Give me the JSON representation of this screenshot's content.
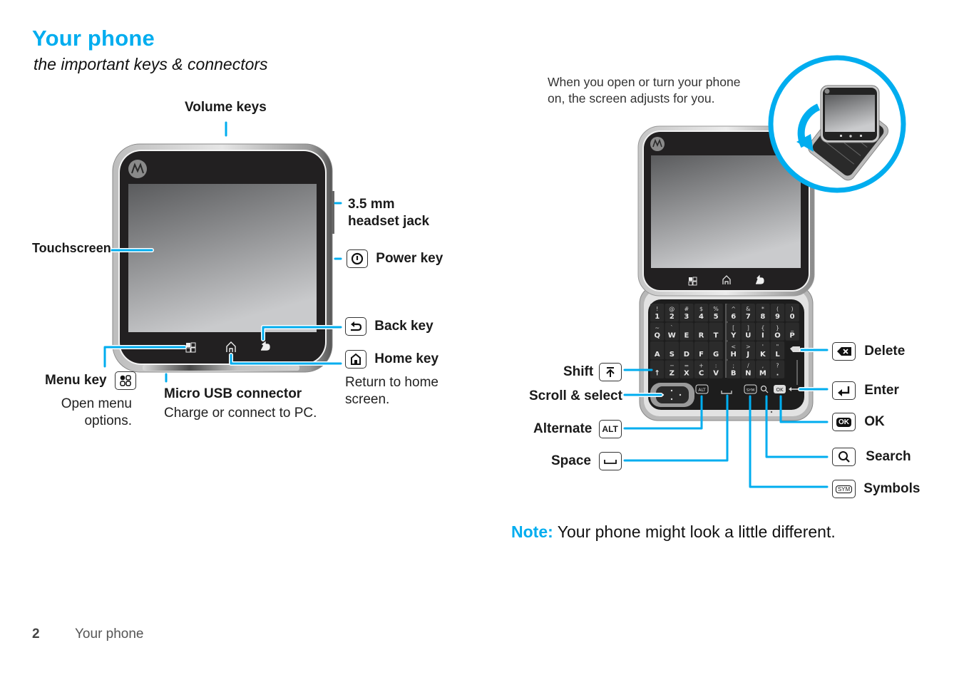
{
  "page": {
    "title": "Your phone",
    "subtitle": "the important keys & connectors",
    "footer": {
      "page_number": "2",
      "section": "Your phone"
    },
    "note": {
      "prefix": "Note:",
      "text": " Your phone might look a little different."
    },
    "accent_color": "#00adef"
  },
  "front_diagram": {
    "labels": {
      "volume_keys": "Volume keys",
      "headset_jack_line1": "3.5 mm",
      "headset_jack_line2": "headset jack",
      "touchscreen": "Touchscreen",
      "power_key": "Power key",
      "back_key": "Back key",
      "home_key": "Home key",
      "home_key_desc_line1": "Return to home",
      "home_key_desc_line2": "screen.",
      "menu_key": "Menu key",
      "menu_key_desc_line1": "Open menu",
      "menu_key_desc_line2": "options.",
      "micro_usb": "Micro USB connector",
      "micro_usb_desc": "Charge or connect to PC."
    }
  },
  "keyboard_diagram": {
    "rotate_text_line1": "When you open or turn your phone",
    "rotate_text_line2": "on, the screen adjusts for you.",
    "labels": {
      "shift": "Shift",
      "scroll_select": "Scroll & select",
      "alternate": "Alternate",
      "space": "Space",
      "delete": "Delete",
      "enter": "Enter",
      "ok": "OK",
      "search": "Search",
      "symbols": "Symbols"
    },
    "key_glyphs": {
      "alt": "ALT",
      "ok": "OK",
      "sym": "SYM"
    },
    "rows": [
      [
        [
          "!",
          "1"
        ],
        [
          "@",
          "2"
        ],
        [
          "#",
          "3"
        ],
        [
          "$",
          "4"
        ],
        [
          "%",
          "5"
        ],
        [
          "^",
          "6"
        ],
        [
          "&",
          "7"
        ],
        [
          "*",
          "8"
        ],
        [
          "(",
          "9"
        ],
        [
          ")",
          "0"
        ]
      ],
      [
        [
          "~",
          "Q"
        ],
        [
          "`",
          "W"
        ],
        [
          "",
          "E"
        ],
        [
          "",
          "R"
        ],
        [
          "",
          "T"
        ],
        [
          "[",
          "Y"
        ],
        [
          "]",
          "U"
        ],
        [
          "{",
          "I"
        ],
        [
          "}",
          "O"
        ],
        [
          "_",
          "P"
        ]
      ],
      [
        [
          "",
          "A"
        ],
        [
          "",
          "S"
        ],
        [
          "",
          "D"
        ],
        [
          "",
          "F"
        ],
        [
          "",
          "G"
        ],
        [
          "<",
          "H"
        ],
        [
          ">",
          "J"
        ],
        [
          "'",
          "K"
        ],
        [
          "\"",
          "L"
        ]
      ],
      [
        [
          "",
          "↑"
        ],
        [
          "−",
          "Z"
        ],
        [
          "=",
          "X"
        ],
        [
          "+",
          "C"
        ],
        [
          ":",
          "V"
        ],
        [
          ";",
          "B"
        ],
        [
          "/",
          "N"
        ],
        [
          ",",
          "M"
        ],
        [
          "?",
          "."
        ]
      ]
    ]
  }
}
